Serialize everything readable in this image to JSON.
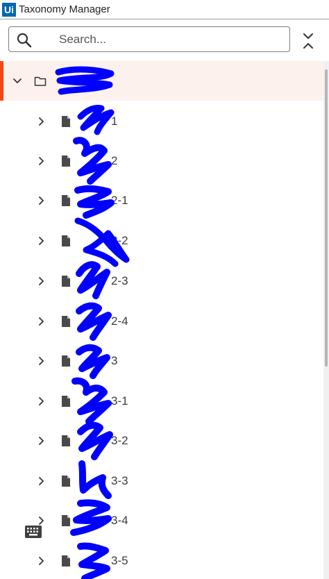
{
  "app": {
    "logo_text": "Ui",
    "title": "Taxonomy Manager"
  },
  "search": {
    "placeholder": "Search...",
    "value": ""
  },
  "tree": {
    "root": {
      "label": ""
    },
    "items": [
      {
        "label": "1"
      },
      {
        "label": "2"
      },
      {
        "label": "2-1"
      },
      {
        "label": "2-2"
      },
      {
        "label": "2-3"
      },
      {
        "label": "2-4"
      },
      {
        "label": "3"
      },
      {
        "label": "3-1"
      },
      {
        "label": "3-2"
      },
      {
        "label": "3-3"
      },
      {
        "label": "3-4"
      },
      {
        "label": "3-5"
      }
    ]
  },
  "colors": {
    "accent": "#fa4616",
    "selected_row": "#fdf1ee",
    "brand": "#0067b1",
    "redaction": "#0000ff"
  },
  "icons": {
    "search": "search-icon",
    "collapse_all": "collapse-all-icon",
    "folder": "folder-icon",
    "document": "document-icon",
    "expand": "chevron-right-icon",
    "collapse": "chevron-down-icon",
    "keyboard": "keyboard-icon"
  }
}
